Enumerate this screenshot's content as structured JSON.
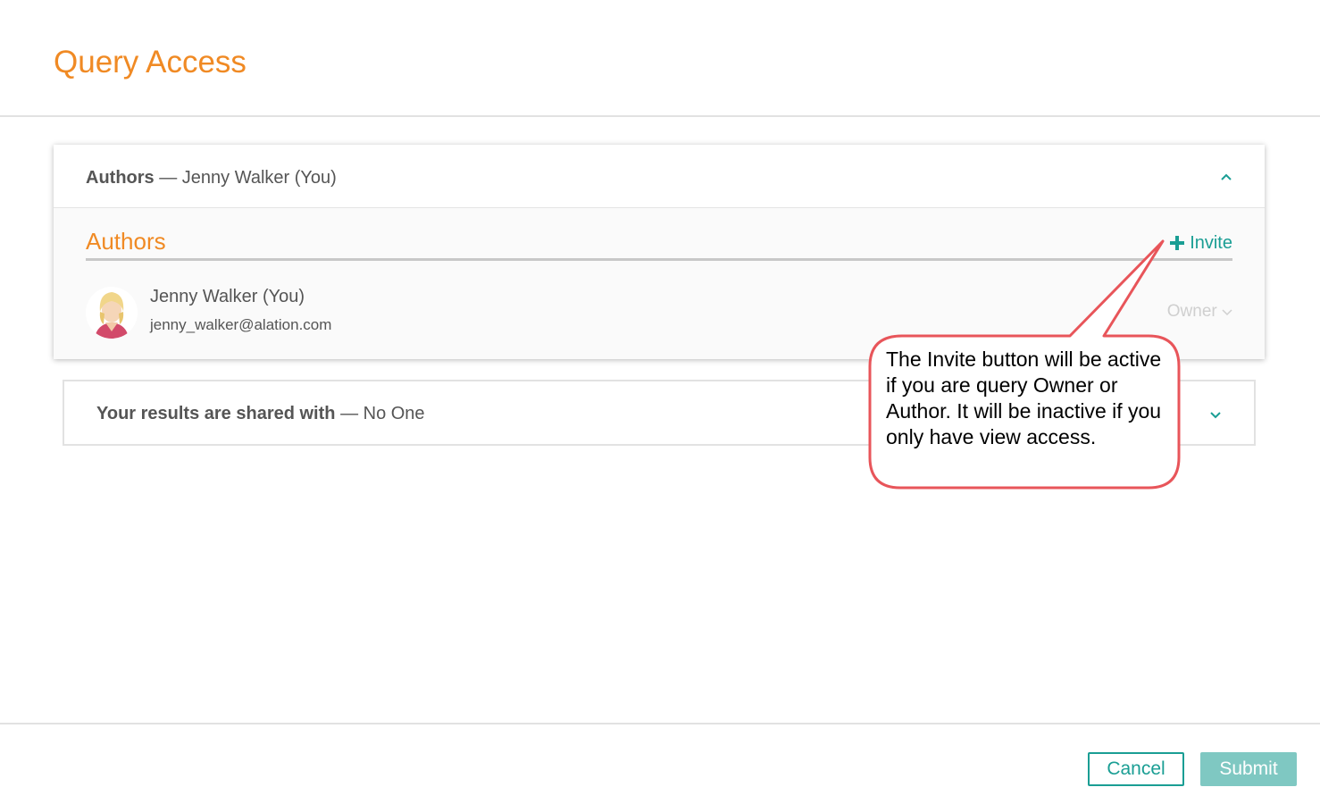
{
  "modal": {
    "title": "Query Access"
  },
  "authors_panel": {
    "header_label": "Authors",
    "header_separator": "—",
    "header_value": "Jenny Walker (You)",
    "section_title": "Authors",
    "invite_icon": "plus-icon",
    "invite_label": "Invite",
    "user": {
      "name": "Jenny Walker (You)",
      "email": "jenny_walker@alation.com",
      "role": "Owner",
      "avatar_icon": "avatar-woman-icon"
    },
    "collapse_icon": "chevron-up-icon"
  },
  "shared_panel": {
    "header_label": "Your results are shared with",
    "header_separator": "—",
    "header_value": "No One",
    "expand_icon": "chevron-down-icon"
  },
  "callout": {
    "text": "The Invite button will be active if you are query Owner or Author. It will be inactive if you only have view access.",
    "border_color": "#e8555a"
  },
  "footer": {
    "cancel_label": "Cancel",
    "submit_label": "Submit"
  },
  "colors": {
    "accent_orange": "#f08a24",
    "accent_teal": "#1a9e94",
    "submit_disabled": "#7fc8c2"
  }
}
